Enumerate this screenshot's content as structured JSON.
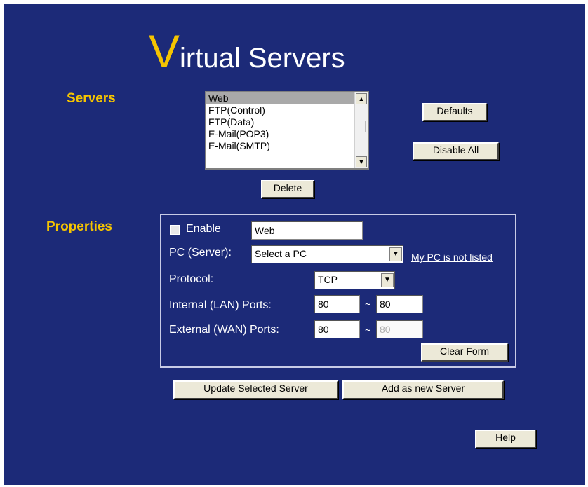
{
  "page": {
    "title_initial": "V",
    "title_rest": "irtual Servers"
  },
  "servers": {
    "heading": "Servers",
    "list": [
      "Web",
      "FTP(Control)",
      "FTP(Data)",
      "E-Mail(POP3)",
      "E-Mail(SMTP)"
    ],
    "selected": "Web",
    "defaults_label": "Defaults",
    "disable_all_label": "Disable All",
    "delete_label": "Delete"
  },
  "properties": {
    "heading": "Properties",
    "enable_label": "Enable",
    "enabled": false,
    "name_value": "Web",
    "pc_label": "PC (Server):",
    "pc_value": "Select a PC",
    "pc_link": "My PC is not listed",
    "protocol_label": "Protocol:",
    "protocol_value": "TCP",
    "internal_label": "Internal (LAN) Ports:",
    "internal_from": "80",
    "internal_to": "80",
    "external_label": "External (WAN) Ports:",
    "external_from": "80",
    "external_to": "80",
    "separator": "~",
    "clear_form_label": "Clear Form"
  },
  "actions": {
    "update_label": "Update Selected Server",
    "add_label": "Add as new Server",
    "help_label": "Help"
  },
  "colors": {
    "background": "#1c2a78",
    "accent": "#f5c400",
    "text": "#ffffff"
  }
}
